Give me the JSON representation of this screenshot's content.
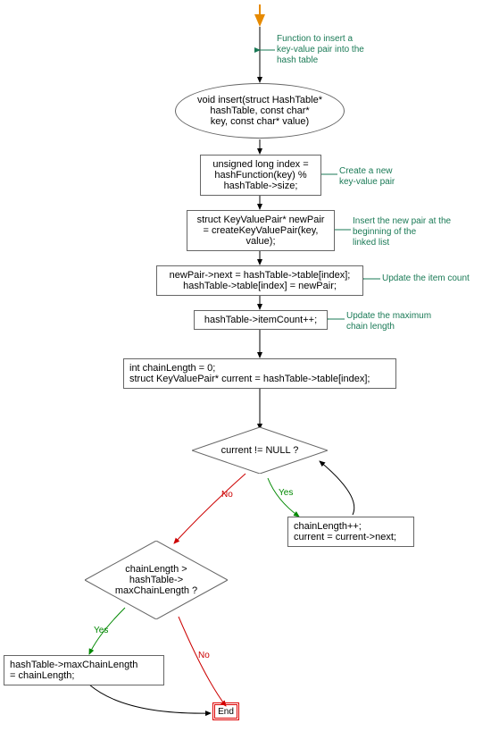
{
  "annotation": {
    "start": "Function to insert a\nkey-value pair into the\nhash table",
    "createPair": "Create a new\nkey-value pair",
    "insertList": "Insert the new pair at the\nbeginning of the\nlinked list",
    "updateCount": "Update the item count",
    "updateMaxChain": "Update the maximum\nchain length"
  },
  "node": {
    "signature": "void insert(struct HashTable*\nhashTable, const char*\nkey, const char* value)",
    "index": "unsigned long index =\nhashFunction(key) %\nhashTable->size;",
    "newPair": "struct KeyValuePair* newPair\n= createKeyValuePair(key,\nvalue);",
    "assign": "newPair->next = hashTable->table[index];\nhashTable->table[index] = newPair;",
    "incr": "hashTable->itemCount++;",
    "chainInit": "int chainLength = 0;\nstruct KeyValuePair* current = hashTable->table[index];",
    "cond1": "current != NULL ?",
    "loopBody": "chainLength++;\ncurrent = current->next;",
    "cond2": "chainLength >\nhashTable->\nmaxChainLength ?",
    "setMax": "hashTable->maxChainLength\n= chainLength;",
    "end": "End"
  },
  "edge": {
    "yes": "Yes",
    "no": "No"
  },
  "chart_data": {
    "type": "flowchart",
    "nodes": [
      {
        "id": "start",
        "kind": "start",
        "label": ""
      },
      {
        "id": "signature",
        "kind": "terminator",
        "label": "void insert(struct HashTable* hashTable, const char* key, const char* value)"
      },
      {
        "id": "index",
        "kind": "process",
        "label": "unsigned long index = hashFunction(key) % hashTable->size;"
      },
      {
        "id": "newPair",
        "kind": "process",
        "label": "struct KeyValuePair* newPair = createKeyValuePair(key, value);"
      },
      {
        "id": "assign",
        "kind": "process",
        "label": "newPair->next = hashTable->table[index]; hashTable->table[index] = newPair;"
      },
      {
        "id": "incr",
        "kind": "process",
        "label": "hashTable->itemCount++;"
      },
      {
        "id": "chainInit",
        "kind": "process",
        "label": "int chainLength = 0; struct KeyValuePair* current = hashTable->table[index];"
      },
      {
        "id": "cond1",
        "kind": "decision",
        "label": "current != NULL ?"
      },
      {
        "id": "loopBody",
        "kind": "process",
        "label": "chainLength++; current = current->next;"
      },
      {
        "id": "cond2",
        "kind": "decision",
        "label": "chainLength > hashTable->maxChainLength ?"
      },
      {
        "id": "setMax",
        "kind": "process",
        "label": "hashTable->maxChainLength = chainLength;"
      },
      {
        "id": "end",
        "kind": "end",
        "label": "End"
      }
    ],
    "edges": [
      {
        "from": "start",
        "to": "signature"
      },
      {
        "from": "signature",
        "to": "index"
      },
      {
        "from": "index",
        "to": "newPair"
      },
      {
        "from": "newPair",
        "to": "assign"
      },
      {
        "from": "assign",
        "to": "incr"
      },
      {
        "from": "incr",
        "to": "chainInit"
      },
      {
        "from": "chainInit",
        "to": "cond1"
      },
      {
        "from": "cond1",
        "to": "loopBody",
        "label": "Yes"
      },
      {
        "from": "loopBody",
        "to": "cond1"
      },
      {
        "from": "cond1",
        "to": "cond2",
        "label": "No"
      },
      {
        "from": "cond2",
        "to": "setMax",
        "label": "Yes"
      },
      {
        "from": "setMax",
        "to": "end"
      },
      {
        "from": "cond2",
        "to": "end",
        "label": "No"
      }
    ],
    "annotations": [
      {
        "target": "start",
        "text": "Function to insert a key-value pair into the hash table"
      },
      {
        "target": "index",
        "text": "Create a new key-value pair"
      },
      {
        "target": "newPair",
        "text": "Insert the new pair at the beginning of the linked list"
      },
      {
        "target": "assign",
        "text": "Update the item count"
      },
      {
        "target": "incr",
        "text": "Update the maximum chain length"
      }
    ]
  }
}
